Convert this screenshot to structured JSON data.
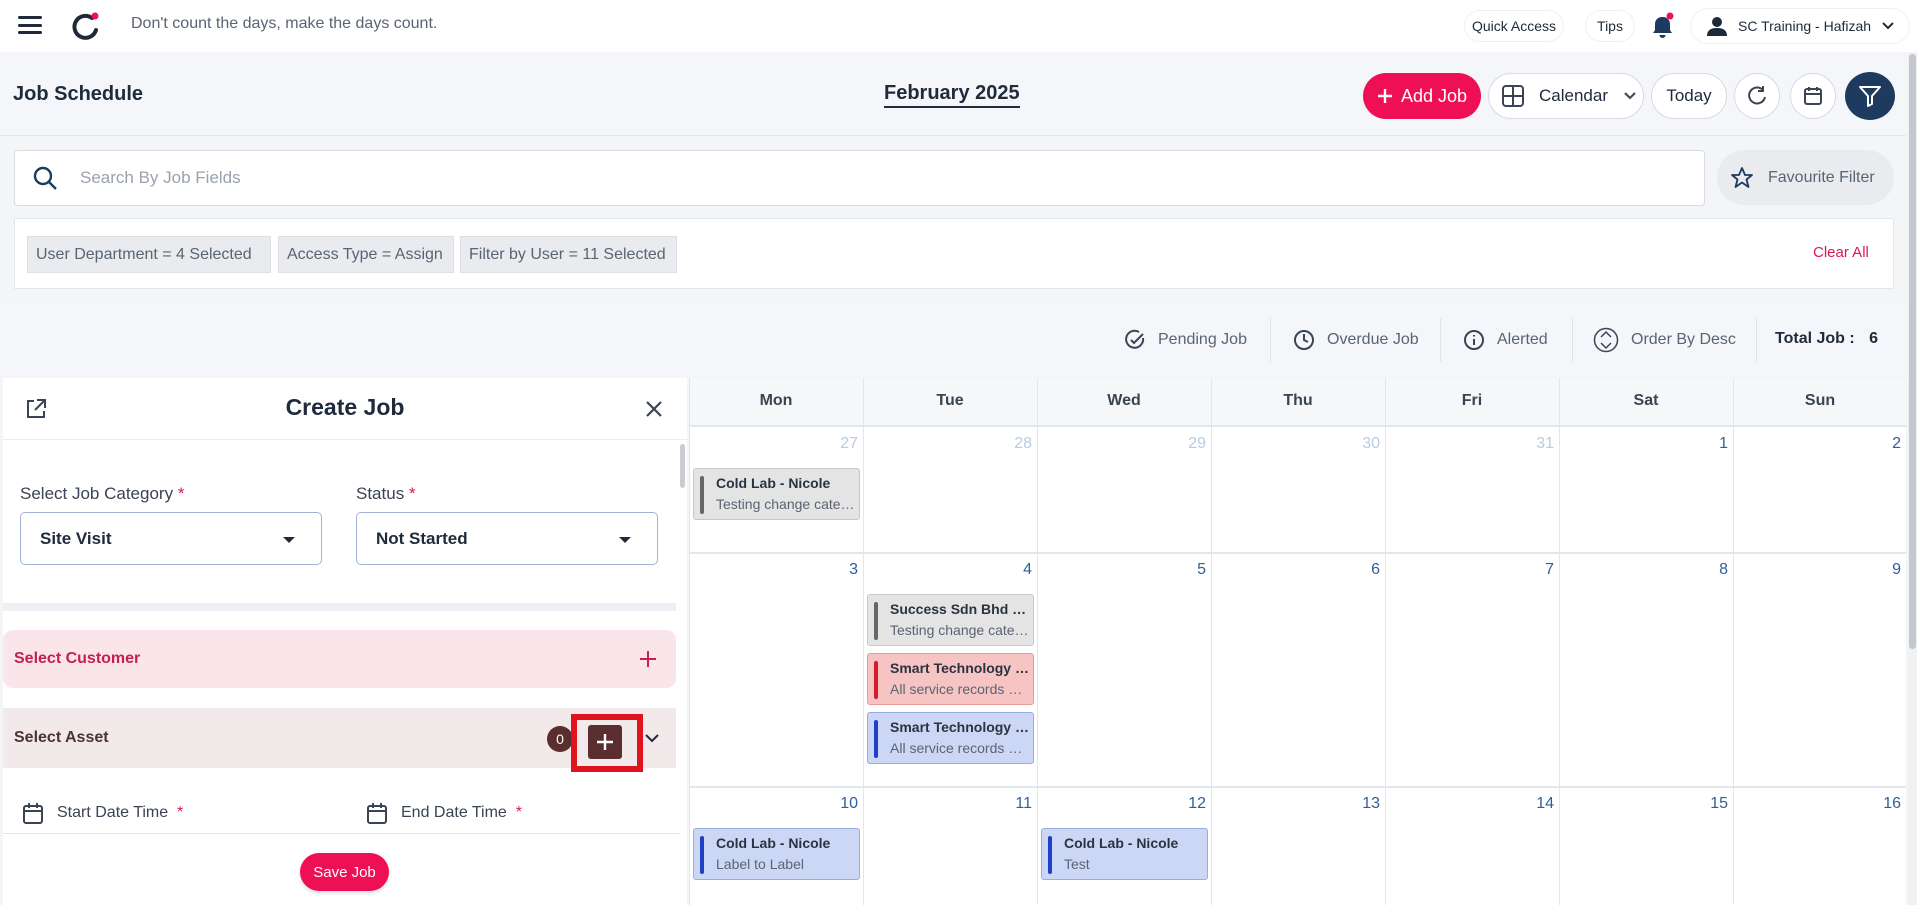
{
  "topbar": {
    "tagline": "Don't count the days, make the days count.",
    "quick_access": "Quick Access",
    "tips": "Tips",
    "user_name": "SC Training - Hafizah"
  },
  "header": {
    "title": "Job Schedule",
    "month": "February 2025",
    "add_job": "Add Job",
    "view_select": "Calendar",
    "today": "Today"
  },
  "search": {
    "placeholder": "Search By Job Fields",
    "favourite_filter": "Favourite Filter"
  },
  "filters": {
    "chips": [
      "User Department  =  4 Selected",
      "Access Type  =  Assign",
      "Filter by User  =  11 Selected"
    ],
    "clear_all": "Clear All"
  },
  "status_bar": {
    "pending": "Pending Job",
    "overdue": "Overdue Job",
    "alerted": "Alerted",
    "order": "Order By Desc",
    "total_label": "Total Job :",
    "total_value": "6"
  },
  "create_job": {
    "title": "Create Job",
    "category_label": "Select Job Category",
    "category_value": "Site Visit",
    "status_label": "Status",
    "status_value": "Not Started",
    "customer_label": "Select Customer",
    "asset_label": "Select Asset",
    "asset_count": "0",
    "start_label": "Start Date Time",
    "end_label": "End Date Time",
    "required_mark": "*",
    "save": "Save Job"
  },
  "calendar": {
    "days_of_week": [
      "Mon",
      "Tue",
      "Wed",
      "Thu",
      "Fri",
      "Sat",
      "Sun"
    ],
    "weeks": [
      [
        "27",
        "28",
        "29",
        "30",
        "31",
        "1",
        "2"
      ],
      [
        "3",
        "4",
        "5",
        "6",
        "7",
        "8",
        "9"
      ],
      [
        "10",
        "11",
        "12",
        "13",
        "14",
        "15",
        "16"
      ]
    ],
    "events": [
      {
        "title": "Cold Lab - Nicole",
        "desc": "Testing change category",
        "color": "grey"
      },
      {
        "title": "Success Sdn Bhd - Johor",
        "desc": "Testing change category",
        "color": "grey"
      },
      {
        "title": "Smart Technology Sdn Bhd",
        "desc": "All service records and",
        "color": "red"
      },
      {
        "title": "Smart Technology Sdn Bhd",
        "desc": "All service records and",
        "color": "blue"
      },
      {
        "title": "Cold Lab - Nicole",
        "desc": "Label to Label",
        "color": "blue"
      },
      {
        "title": "Cold Lab - Nicole",
        "desc": "Test",
        "color": "blue"
      }
    ]
  },
  "colors": {
    "brand": "#ef0f55",
    "navy": "#1e3a5f",
    "asset_brown": "#5a2d2f",
    "highlight": "#e0141e"
  }
}
